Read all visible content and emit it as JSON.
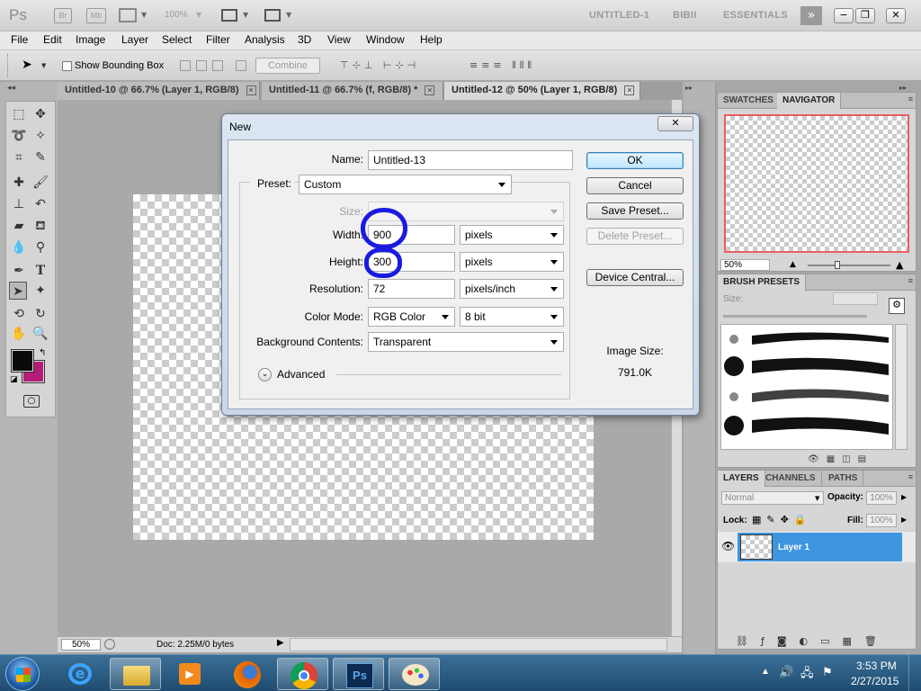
{
  "appbar": {
    "logo": "Ps",
    "bridge": "Br",
    "minibridge": "Mb",
    "zoom": "100%",
    "workspaces": [
      "UNTITLED-1",
      "BIBII",
      "ESSENTIALS"
    ],
    "more_icon": "double-chevron-right-icon"
  },
  "menu": [
    "File",
    "Edit",
    "Image",
    "Layer",
    "Select",
    "Filter",
    "Analysis",
    "3D",
    "View",
    "Window",
    "Help"
  ],
  "options": {
    "show_bounding_box": "Show Bounding Box",
    "combine": "Combine"
  },
  "tabs": [
    {
      "label": "Untitled-10 @ 66.7% (Layer 1, RGB/8)",
      "active": false
    },
    {
      "label": "Untitled-11 @ 66.7% (f, RGB/8) *",
      "active": false
    },
    {
      "label": "Untitled-12 @ 50% (Layer 1, RGB/8)",
      "active": true
    }
  ],
  "status": {
    "zoom": "50%",
    "doc": "Doc: 2.25M/0 bytes"
  },
  "navigator": {
    "tabs": [
      "SWATCHES",
      "NAVIGATOR"
    ],
    "zoom": "50%"
  },
  "brush_presets": {
    "tab": "BRUSH PRESETS",
    "size_label": "Size:"
  },
  "layers": {
    "tabs": [
      "LAYERS",
      "CHANNELS",
      "PATHS"
    ],
    "blend_mode": "Normal",
    "opacity_label": "Opacity:",
    "opacity": "100%",
    "lock_label": "Lock:",
    "fill_label": "Fill:",
    "fill": "100%",
    "layer_name": "Layer 1"
  },
  "dialog": {
    "title": "New",
    "name_label": "Name:",
    "name_value": "Untitled-13",
    "preset_label": "Preset:",
    "preset_value": "Custom",
    "size_label": "Size:",
    "width_label": "Width:",
    "width_value": "900",
    "width_unit": "pixels",
    "height_label": "Height:",
    "height_value": "300",
    "height_unit": "pixels",
    "resolution_label": "Resolution:",
    "resolution_value": "72",
    "resolution_unit": "pixels/inch",
    "color_mode_label": "Color Mode:",
    "color_mode_value": "RGB Color",
    "bit_depth": "8 bit",
    "bg_label": "Background Contents:",
    "bg_value": "Transparent",
    "advanced_label": "Advanced",
    "ok": "OK",
    "cancel": "Cancel",
    "save_preset": "Save Preset...",
    "delete_preset": "Delete Preset...",
    "device_central": "Device Central...",
    "image_size_label": "Image Size:",
    "image_size_value": "791.0K"
  },
  "taskbar": {
    "time": "3:53 PM",
    "date": "2/27/2015",
    "apps": [
      "internet-explorer-icon",
      "file-explorer-icon",
      "media-player-icon",
      "firefox-icon",
      "chrome-icon",
      "photoshop-icon",
      "paint-icon"
    ]
  },
  "colors": {
    "foreground": "#0a0a0a",
    "background": "#b51c78",
    "annotation": "#1a1ae0",
    "layer_selected": "#3e95e0"
  }
}
